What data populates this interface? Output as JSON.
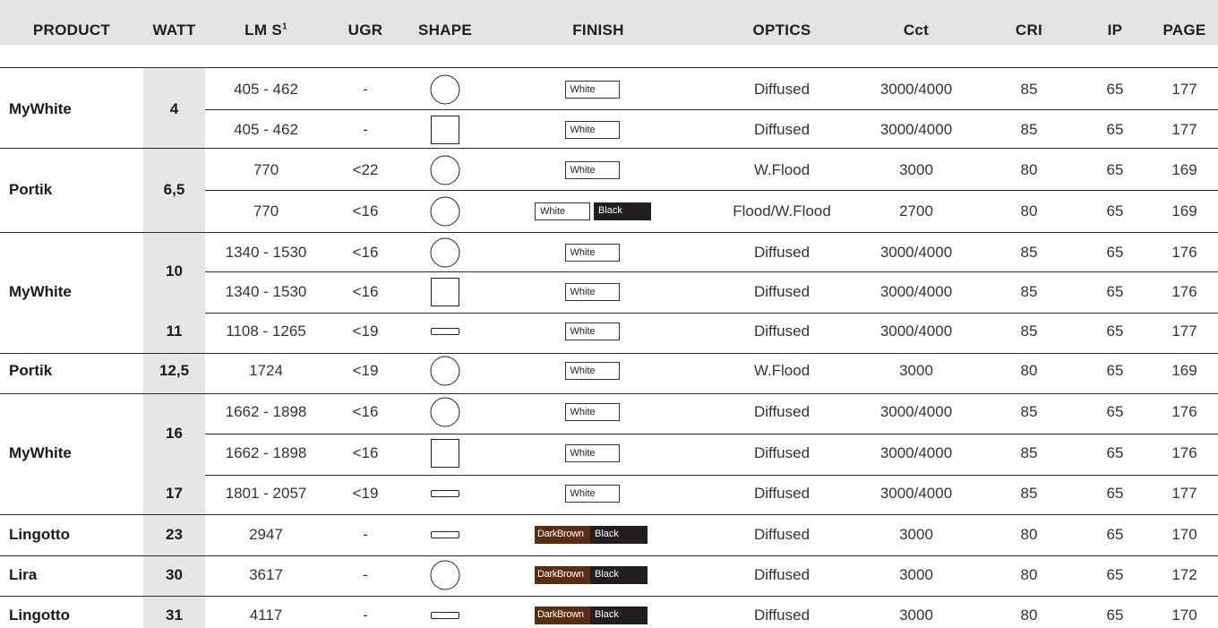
{
  "headers": {
    "product": "PRODUCT",
    "watt": "WATT",
    "lms": "LM S",
    "lms_sup": "1",
    "ugr": "UGR",
    "shape": "SHAPE",
    "finish": "FINISH",
    "optics": "OPTICS",
    "cct": "Cct",
    "cri": "CRI",
    "ip": "IP",
    "page": "PAGE"
  },
  "products": [
    {
      "name": "MyWhite"
    },
    {
      "name": "Portik"
    },
    {
      "name": "MyWhite"
    },
    {
      "name": "Portik"
    },
    {
      "name": "MyWhite"
    },
    {
      "name": "Lingotto"
    },
    {
      "name": "Lira"
    },
    {
      "name": "Lingotto"
    }
  ],
  "watts": [
    {
      "value": "4"
    },
    {
      "value": "6,5"
    },
    {
      "value": "10"
    },
    {
      "value": "11"
    },
    {
      "value": "12,5"
    },
    {
      "value": "16"
    },
    {
      "value": "17"
    },
    {
      "value": "23"
    },
    {
      "value": "30"
    },
    {
      "value": "31"
    }
  ],
  "rows": [
    {
      "lms": "405 - 462",
      "ugr": "-",
      "shape": "circle",
      "finish": [
        "White"
      ],
      "optics": "Diffused",
      "cct": "3000/4000",
      "cri": "85",
      "ip": "65",
      "page": "177"
    },
    {
      "lms": "405 - 462",
      "ugr": "-",
      "shape": "square",
      "finish": [
        "White"
      ],
      "optics": "Diffused",
      "cct": "3000/4000",
      "cri": "85",
      "ip": "65",
      "page": "177"
    },
    {
      "lms": "770",
      "ugr": "<22",
      "shape": "circle",
      "finish": [
        "White"
      ],
      "optics": "W.Flood",
      "cct": "3000",
      "cri": "80",
      "ip": "65",
      "page": "169"
    },
    {
      "lms": "770",
      "ugr": "<16",
      "shape": "circle",
      "finish": [
        "White",
        "Black"
      ],
      "optics": "Flood/W.Flood",
      "cct": "2700",
      "cri": "80",
      "ip": "65",
      "page": "169"
    },
    {
      "lms": "1340 - 1530",
      "ugr": "<16",
      "shape": "circle",
      "finish": [
        "White"
      ],
      "optics": "Diffused",
      "cct": "3000/4000",
      "cri": "85",
      "ip": "65",
      "page": "176"
    },
    {
      "lms": "1340 - 1530",
      "ugr": "<16",
      "shape": "square",
      "finish": [
        "White"
      ],
      "optics": "Diffused",
      "cct": "3000/4000",
      "cri": "85",
      "ip": "65",
      "page": "176"
    },
    {
      "lms": "1108 - 1265",
      "ugr": "<19",
      "shape": "rectangle",
      "finish": [
        "White"
      ],
      "optics": "Diffused",
      "cct": "3000/4000",
      "cri": "85",
      "ip": "65",
      "page": "177"
    },
    {
      "lms": "1724",
      "ugr": "<19",
      "shape": "circle",
      "finish": [
        "White"
      ],
      "optics": "W.Flood",
      "cct": "3000",
      "cri": "80",
      "ip": "65",
      "page": "169"
    },
    {
      "lms": "1662 - 1898",
      "ugr": "<16",
      "shape": "circle",
      "finish": [
        "White"
      ],
      "optics": "Diffused",
      "cct": "3000/4000",
      "cri": "85",
      "ip": "65",
      "page": "176"
    },
    {
      "lms": "1662 - 1898",
      "ugr": "<16",
      "shape": "square",
      "finish": [
        "White"
      ],
      "optics": "Diffused",
      "cct": "3000/4000",
      "cri": "85",
      "ip": "65",
      "page": "176"
    },
    {
      "lms": "1801 - 2057",
      "ugr": "<19",
      "shape": "rectangle",
      "finish": [
        "White"
      ],
      "optics": "Diffused",
      "cct": "3000/4000",
      "cri": "85",
      "ip": "65",
      "page": "177"
    },
    {
      "lms": "2947",
      "ugr": "-",
      "shape": "rectangle",
      "finish": [
        "DarkBrown",
        "Black"
      ],
      "optics": "Diffused",
      "cct": "3000",
      "cri": "80",
      "ip": "65",
      "page": "170"
    },
    {
      "lms": "3617",
      "ugr": "-",
      "shape": "circle",
      "finish": [
        "DarkBrown",
        "Black"
      ],
      "optics": "Diffused",
      "cct": "3000",
      "cri": "80",
      "ip": "65",
      "page": "172"
    },
    {
      "lms": "4117",
      "ugr": "-",
      "shape": "rectangle",
      "finish": [
        "DarkBrown",
        "Black"
      ],
      "optics": "Diffused",
      "cct": "3000",
      "cri": "80",
      "ip": "65",
      "page": "170"
    }
  ],
  "finish_colors": {
    "White": "#ffffff",
    "Black": "#221e1e",
    "DarkBrown": "#5b2d10"
  }
}
